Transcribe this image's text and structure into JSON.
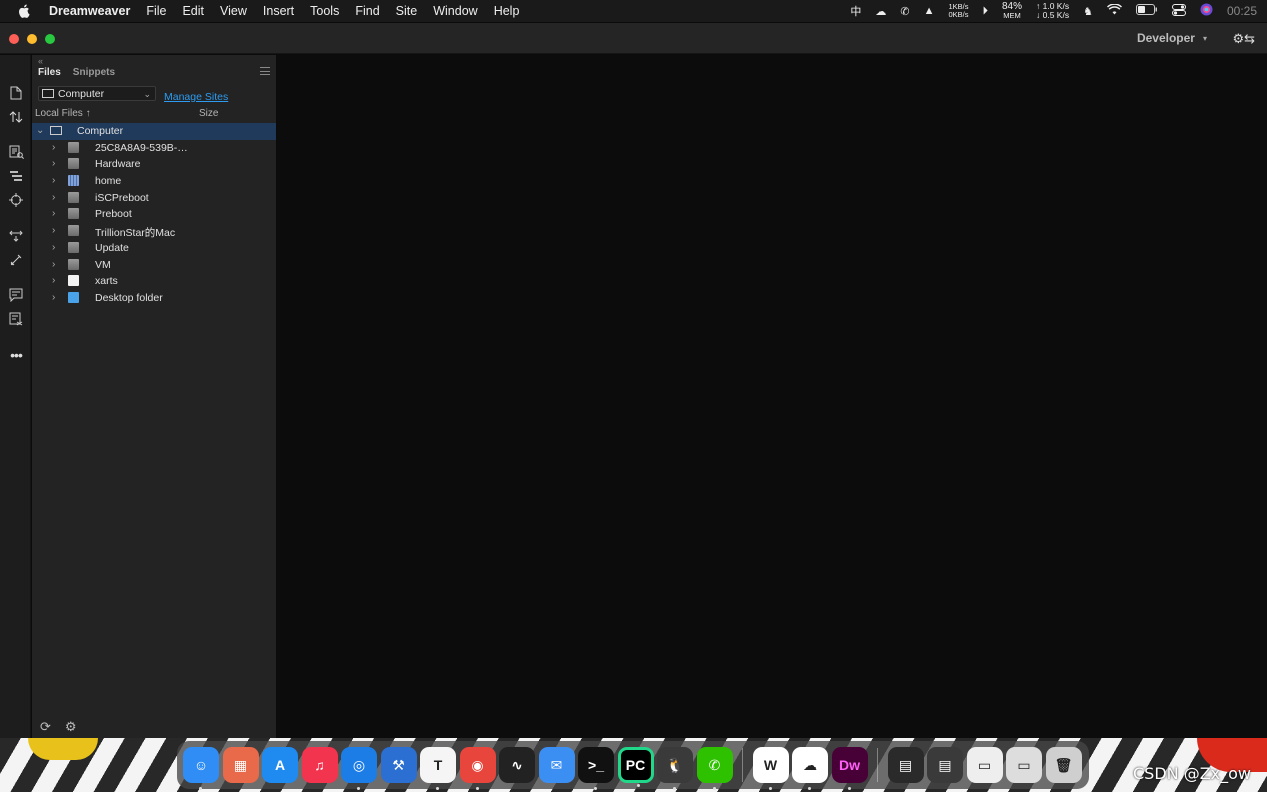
{
  "menubar": {
    "app_name": "Dreamweaver",
    "items": [
      "File",
      "Edit",
      "View",
      "Insert",
      "Tools",
      "Find",
      "Site",
      "Window",
      "Help"
    ],
    "input_method": "中",
    "net_up": "1KB/s",
    "net_down": "0KB/s",
    "mem_percent": "84%",
    "mem_label": "MEM",
    "speed_up": "↑ 1.0 K/s",
    "speed_down": "↓ 0.5 K/s",
    "clock": "00:25"
  },
  "titlebar": {
    "workspace_label": "Developer"
  },
  "panel": {
    "tabs": [
      "Files",
      "Snippets"
    ],
    "site_select": "Computer",
    "manage_sites": "Manage Sites",
    "col_local": "Local Files",
    "col_size": "Size",
    "tree": [
      {
        "label": "Computer",
        "icon": "computer-icon",
        "root": true
      },
      {
        "label": "25C8A8A9-539B-…",
        "icon": "drive-icon"
      },
      {
        "label": "Hardware",
        "icon": "drive-icon"
      },
      {
        "label": "home",
        "icon": "home-drive-icon"
      },
      {
        "label": "iSCPreboot",
        "icon": "drive-icon"
      },
      {
        "label": "Preboot",
        "icon": "drive-icon"
      },
      {
        "label": "TrillionStar的Mac",
        "icon": "drive-icon"
      },
      {
        "label": "Update",
        "icon": "drive-icon"
      },
      {
        "label": "VM",
        "icon": "drive-icon"
      },
      {
        "label": "xarts",
        "icon": "document-icon"
      },
      {
        "label": "Desktop folder",
        "icon": "folder-icon"
      }
    ]
  },
  "dock": {
    "apps": [
      {
        "name": "finder-icon",
        "color": "#2f8df5",
        "glyph": "☺"
      },
      {
        "name": "launchpad-icon",
        "color": "#e86a4a",
        "glyph": "▦"
      },
      {
        "name": "app-store-icon",
        "color": "#1f8af0",
        "glyph": "A"
      },
      {
        "name": "music-icon",
        "color": "#f3344f",
        "glyph": "♫"
      },
      {
        "name": "safari-icon",
        "color": "#1d7de6",
        "glyph": "◎"
      },
      {
        "name": "xcode-icon",
        "color": "#2a6fd1",
        "glyph": "⚒"
      },
      {
        "name": "typora-icon",
        "color": "#f5f5f5",
        "glyph": "T"
      },
      {
        "name": "chrome-icon",
        "color": "#e8453c",
        "glyph": "◉"
      },
      {
        "name": "activity-monitor-icon",
        "color": "#222222",
        "glyph": "∿"
      },
      {
        "name": "mail-icon",
        "color": "#3b8ff3",
        "glyph": "✉"
      },
      {
        "name": "terminal-icon",
        "color": "#111111",
        "glyph": ">_"
      },
      {
        "name": "pycharm-icon",
        "color": "#21d789",
        "glyph": "PC"
      },
      {
        "name": "qq-icon",
        "color": "#3a3a3a",
        "glyph": "🐧"
      },
      {
        "name": "wechat-icon",
        "color": "#2dc100",
        "glyph": "✆"
      },
      {
        "name": "wps-icon",
        "color": "#ffffff",
        "glyph": "W"
      },
      {
        "name": "baidu-netdisk-icon",
        "color": "#ffffff",
        "glyph": "☁"
      },
      {
        "name": "dreamweaver-icon",
        "color": "#470137",
        "glyph": "Dw"
      },
      {
        "name": "window-thumb-1-icon",
        "color": "#2a2a2a",
        "glyph": "▤"
      },
      {
        "name": "window-thumb-2-icon",
        "color": "#3a3a3a",
        "glyph": "▤"
      },
      {
        "name": "window-thumb-3-icon",
        "color": "#eeeeee",
        "glyph": "▭"
      },
      {
        "name": "window-thumb-4-icon",
        "color": "#dddddd",
        "glyph": "▭"
      },
      {
        "name": "trash-icon",
        "color": "#cfcfcf",
        "glyph": "🗑"
      }
    ]
  },
  "watermark": "CSDN @Zx_ow"
}
